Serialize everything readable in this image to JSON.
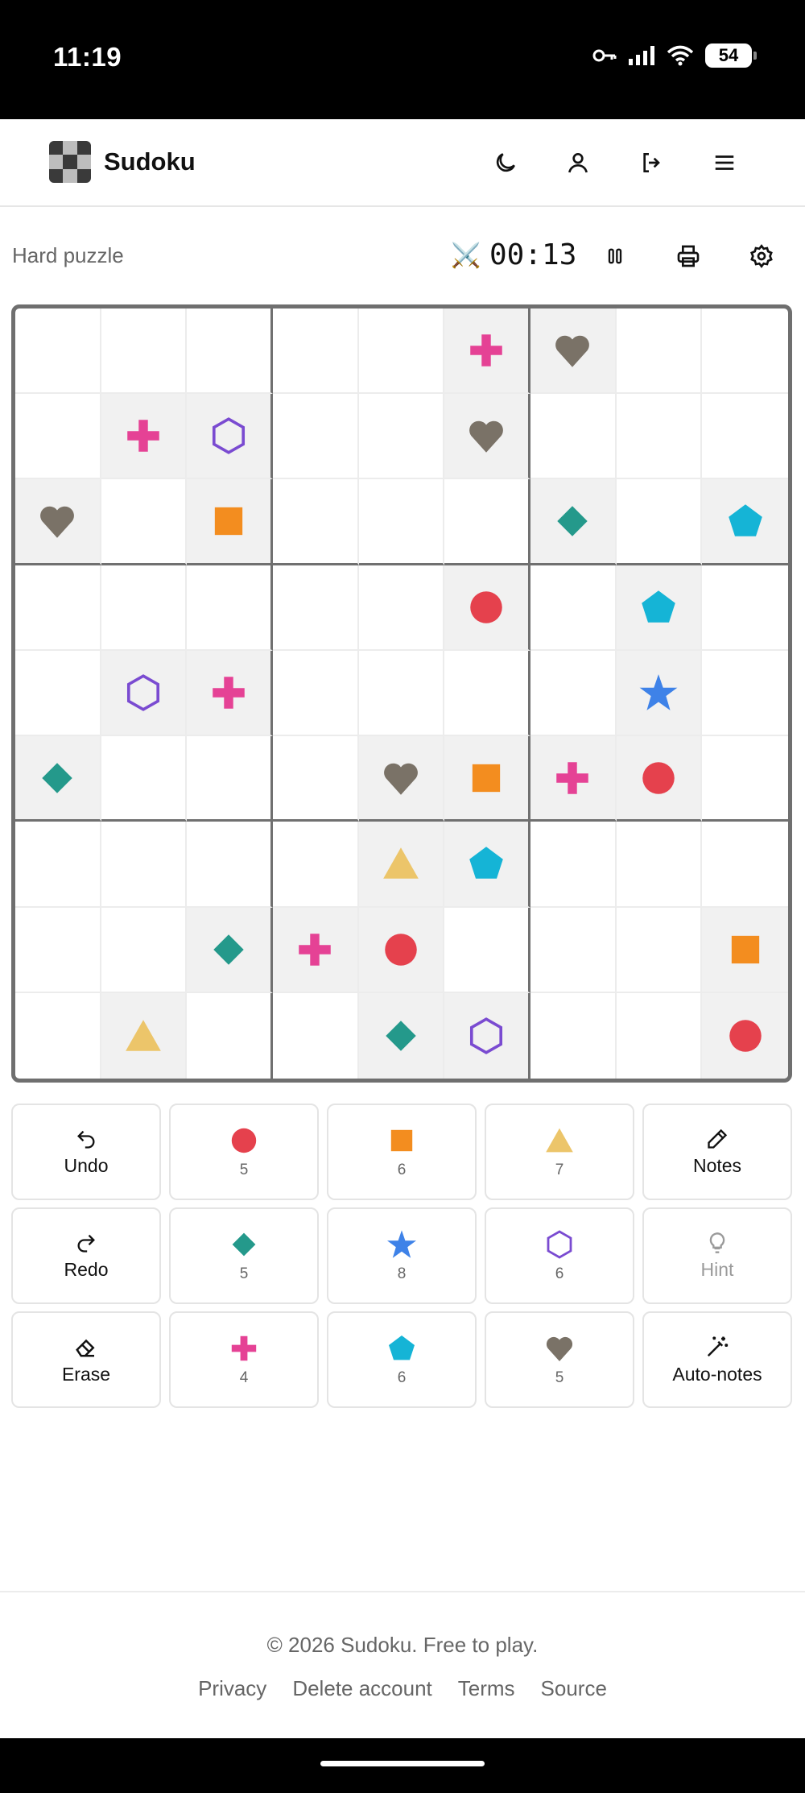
{
  "status_bar": {
    "time": "11:19",
    "battery": "54"
  },
  "header": {
    "title": "Sudoku",
    "icons": [
      "moon-icon",
      "user-icon",
      "logout-icon",
      "menu-icon"
    ]
  },
  "toolbar": {
    "difficulty": "Hard puzzle",
    "timer": "00:13"
  },
  "symbols": {
    "circle": {
      "name": "circle",
      "color": "#e5414d"
    },
    "square": {
      "name": "square",
      "color": "#f38d1f"
    },
    "triangle": {
      "name": "triangle",
      "color": "#ecc56a"
    },
    "diamond": {
      "name": "diamond",
      "color": "#24998b"
    },
    "star": {
      "name": "star",
      "color": "#3e82e8"
    },
    "hexagon": {
      "name": "hexagon",
      "color": "#7a4bd1"
    },
    "cross": {
      "name": "cross",
      "color": "#e54295"
    },
    "pentagon": {
      "name": "pentagon",
      "color": "#15b4d6"
    },
    "heart": {
      "name": "heart",
      "color": "#7a7267"
    }
  },
  "board": [
    [
      "",
      "",
      "",
      "",
      "",
      "cross",
      "heart",
      "",
      ""
    ],
    [
      "",
      "cross",
      "hexagon",
      "",
      "",
      "heart",
      "",
      "",
      ""
    ],
    [
      "heart",
      "",
      "square",
      "",
      "",
      "",
      "diamond",
      "",
      "pentagon"
    ],
    [
      "",
      "",
      "",
      "",
      "",
      "circle",
      "",
      "pentagon",
      ""
    ],
    [
      "",
      "hexagon",
      "cross",
      "",
      "",
      "",
      "",
      "star",
      ""
    ],
    [
      "diamond",
      "",
      "",
      "",
      "heart",
      "square",
      "cross",
      "circle",
      ""
    ],
    [
      "",
      "",
      "",
      "",
      "triangle",
      "pentagon",
      "",
      "",
      ""
    ],
    [
      "",
      "",
      "diamond",
      "cross",
      "circle",
      "",
      "",
      "",
      "square"
    ],
    [
      "",
      "triangle",
      "",
      "",
      "diamond",
      "hexagon",
      "",
      "",
      "circle"
    ]
  ],
  "controls": {
    "undo": "Undo",
    "redo": "Redo",
    "erase": "Erase",
    "notes": "Notes",
    "hint": "Hint",
    "auto_notes": "Auto-notes",
    "counts": {
      "circle": "5",
      "square": "6",
      "triangle": "7",
      "diamond": "5",
      "star": "8",
      "hexagon": "6",
      "cross": "4",
      "pentagon": "6",
      "heart": "5"
    }
  },
  "footer": {
    "copyright": "© 2026 Sudoku. Free to play.",
    "links": {
      "privacy": "Privacy",
      "delete_account": "Delete account",
      "terms": "Terms",
      "source": "Source"
    }
  }
}
